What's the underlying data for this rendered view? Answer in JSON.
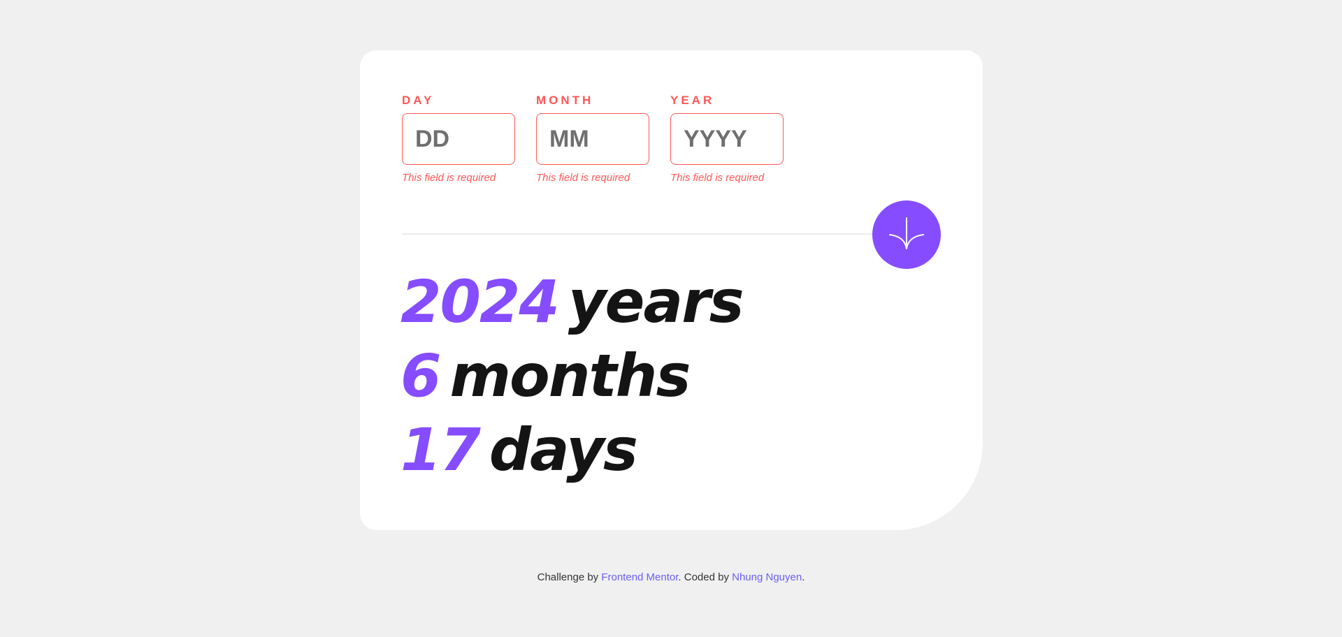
{
  "form": {
    "fields": [
      {
        "label": "DAY",
        "placeholder": "DD",
        "value": "",
        "error": "This field is required"
      },
      {
        "label": "MONTH",
        "placeholder": "MM",
        "value": "",
        "error": "This field is required"
      },
      {
        "label": "YEAR",
        "placeholder": "YYYY",
        "value": "",
        "error": "This field is required"
      }
    ],
    "submit_icon": "arrow-down-icon"
  },
  "results": {
    "years": {
      "value": "2024",
      "unit": "years"
    },
    "months": {
      "value": "6",
      "unit": "months"
    },
    "days": {
      "value": "17",
      "unit": "days"
    }
  },
  "footer": {
    "prefix": "Challenge by ",
    "challenge_link": "Frontend Mentor",
    "middle": ". Coded by ",
    "author_link": "Nhung Nguyen",
    "suffix": "."
  },
  "colors": {
    "accent": "#854dff",
    "error": "#ff5757",
    "background": "#f0f0f0",
    "card": "#ffffff",
    "text": "#141414"
  }
}
